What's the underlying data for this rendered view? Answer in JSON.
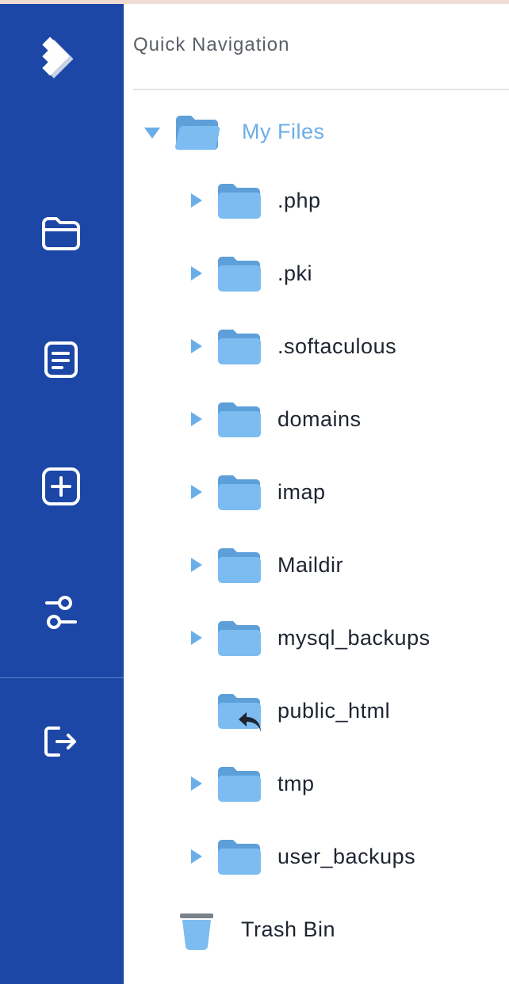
{
  "panel": {
    "title": "Quick Navigation"
  },
  "rail": {
    "icons": [
      "logo-icon",
      "folder-icon",
      "document-icon",
      "plus-square-icon",
      "settings-icon",
      "logout-icon"
    ]
  },
  "tree": {
    "root": {
      "label": "My Files",
      "expanded": true
    },
    "items": [
      {
        "label": ".php",
        "expandable": true
      },
      {
        "label": ".pki",
        "expandable": true
      },
      {
        "label": ".softaculous",
        "expandable": true
      },
      {
        "label": "domains",
        "expandable": true
      },
      {
        "label": "imap",
        "expandable": true
      },
      {
        "label": "Maildir",
        "expandable": true
      },
      {
        "label": "mysql_backups",
        "expandable": true
      },
      {
        "label": "public_html",
        "expandable": false,
        "shortcut": true
      },
      {
        "label": "tmp",
        "expandable": true
      },
      {
        "label": "user_backups",
        "expandable": true
      }
    ],
    "trash": {
      "label": "Trash Bin"
    }
  },
  "colors": {
    "rail": "#1d47a6",
    "accent": "#6aaee8",
    "folder_front": "#7dbcf0",
    "folder_back": "#5d9fd9",
    "text": "#1e2430"
  }
}
